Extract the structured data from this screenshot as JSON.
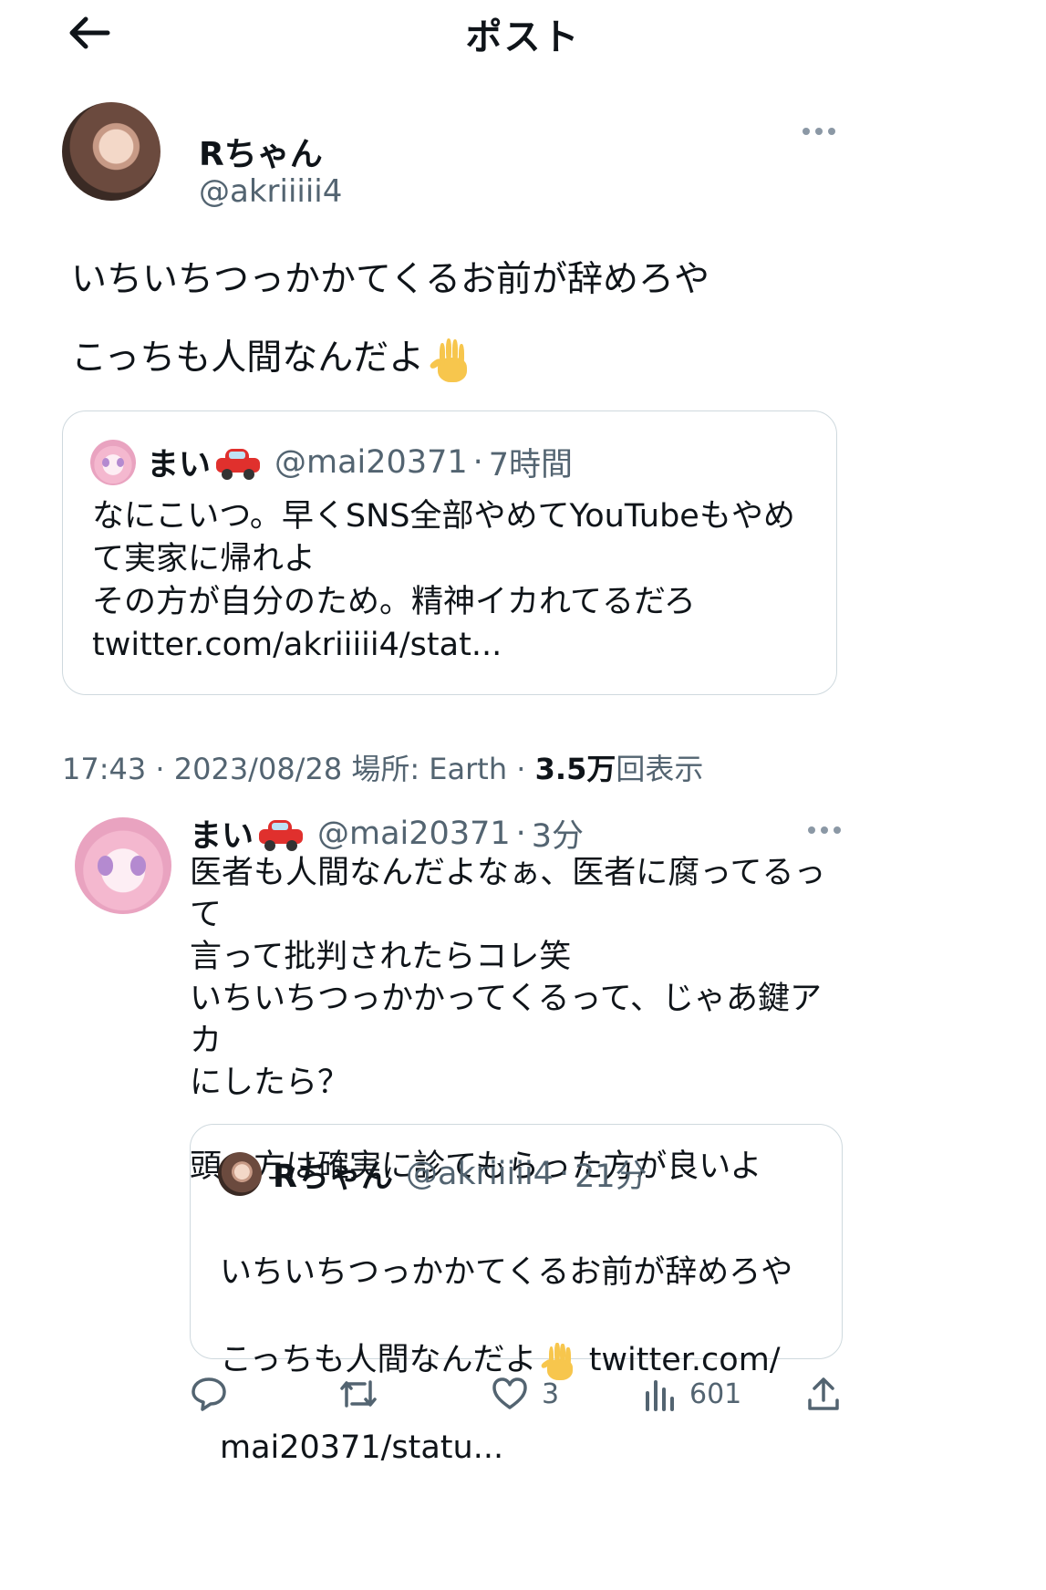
{
  "header": {
    "back_label": "←",
    "title": "ポスト"
  },
  "author": {
    "name": "Rちゃん",
    "handle": "@akriiiii4"
  },
  "post": {
    "text": "いちいちつっかかてくるお前が辞めろや\nこっちも人間なんだよ",
    "hand_emoji": "✋",
    "quote": {
      "name": "まい",
      "handle": "@mai20371",
      "sep": "·",
      "time": "7時間",
      "car_emoji": "🚗",
      "text": "なにこいつ。早くSNS全部やめてYouTubeもやめ\nて実家に帰れよ\nその方が自分のため。精神イカれてるだろ\ntwitter.com/akriiiii4/stat..."
    }
  },
  "meta": {
    "time": "17:43",
    "date": "2023/08/28",
    "location": "場所: Earth",
    "views_count": "3.5万",
    "views_label": "回表示"
  },
  "reply": {
    "name": "まい",
    "handle": "@mai20371",
    "sep": "·",
    "time": "3分",
    "car_emoji": "🚗",
    "text": "医者も人間なんだよなぁ、医者に腐ってるって\n言って批判されたらコレ笑\nいちいちつっかかってくるって、じゃあ鍵アカ\nにしたら？\n\n頭の方は確実に診てもらった方が良いよ",
    "quote": {
      "name": "Rちゃん",
      "handle": "@akriiiii4",
      "sep": "·",
      "time": "21分",
      "text_line1": "いちいちつっかかてくるお前が辞めろや",
      "text_line2_a": "こっちも人間なんだよ",
      "text_line2_b": " twitter.com/",
      "text_line3": "mai20371/statu..."
    }
  },
  "actions": {
    "reply_icon": "reply-icon",
    "retweet_icon": "retweet-icon",
    "like_count": "3",
    "views_count": "601",
    "share_icon": "share-icon"
  },
  "colors": {
    "text": "#0f1419",
    "secondary": "#536471",
    "border": "#cfd9de"
  }
}
